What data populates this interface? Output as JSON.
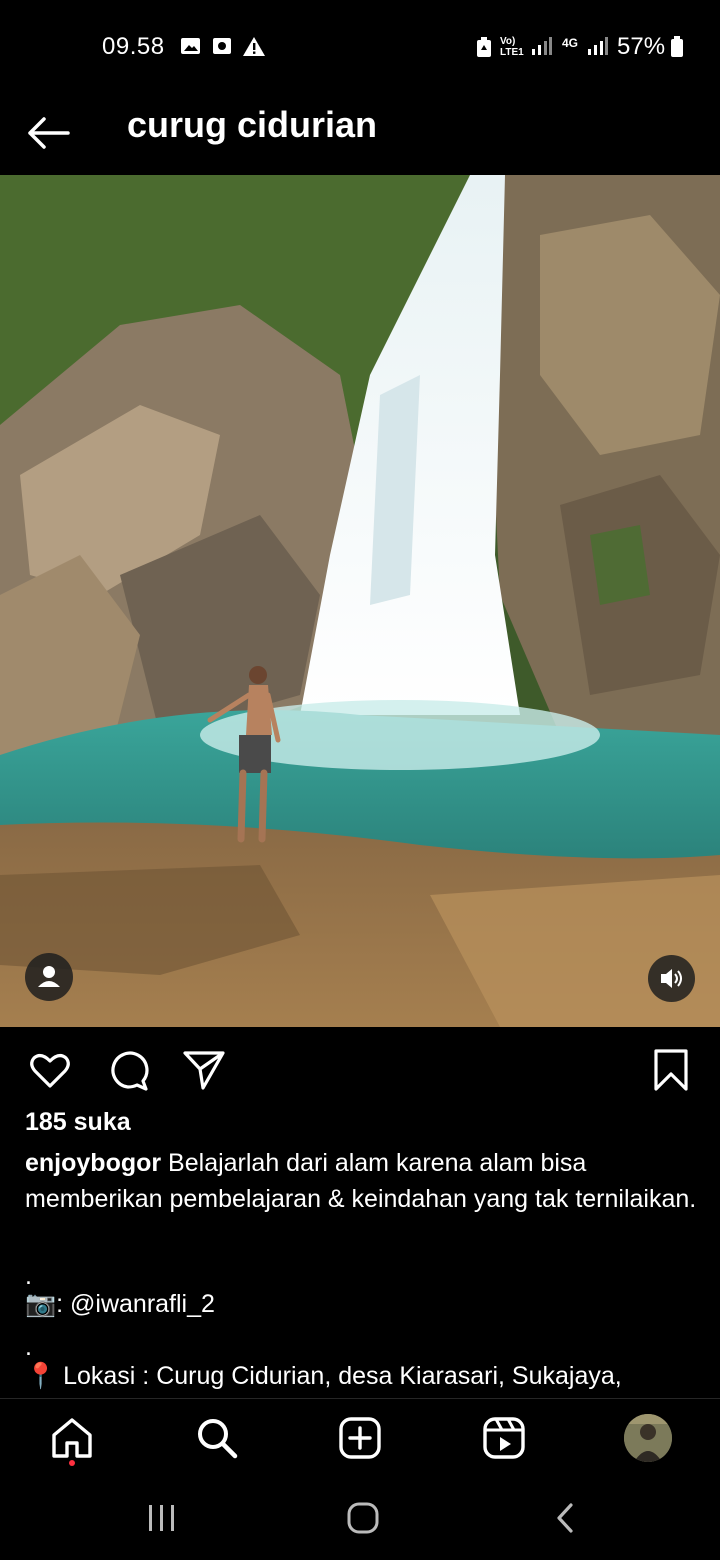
{
  "status_bar": {
    "time": "09.58",
    "battery": "57%",
    "network_1": "Vo) LTE1",
    "network_2": "4G",
    "icons": [
      "gallery-icon",
      "screen-record-icon",
      "warning-icon",
      "recycle-icon",
      "signal-icon",
      "battery-icon"
    ]
  },
  "header": {
    "title": "curug cidurian",
    "back_icon": "back-arrow-icon"
  },
  "post": {
    "likes": "185 suka",
    "username": "enjoybogor",
    "caption": " Belajarlah dari alam karena alam bisa memberikan pembelajaran & keindahan yang tak ternilaikan.",
    "dot_1": ".",
    "credit_emoji": "📷",
    "credit": ": @iwanrafli_2",
    "dot_2": ".",
    "location_emoji": "📍",
    "location": " Lokasi : Curug Cidurian, desa Kiarasari, Sukajaya,"
  },
  "actions": [
    "like-icon",
    "comment-icon",
    "share-icon",
    "save-icon"
  ],
  "bottom_nav": [
    "home-icon",
    "search-icon",
    "create-icon",
    "reels-icon",
    "profile-avatar"
  ],
  "colors": {
    "background": "#000000",
    "text": "#ffffff",
    "notification": "#ff3040"
  }
}
